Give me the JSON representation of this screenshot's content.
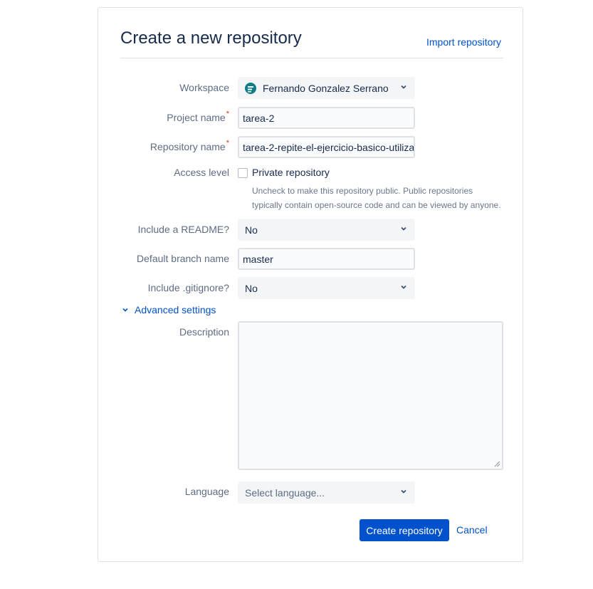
{
  "page": {
    "title": "Create a new repository",
    "import_link": "Import repository"
  },
  "form": {
    "workspace": {
      "label": "Workspace",
      "value": "Fernando Gonzalez Serrano",
      "icon": "workspace-avatar-icon"
    },
    "project_name": {
      "label": "Project name",
      "required_mark": "*",
      "value": "tarea-2"
    },
    "repository_name": {
      "label": "Repository name",
      "required_mark": "*",
      "value": "tarea-2-repite-el-ejercicio-basico-utiliza"
    },
    "access_level": {
      "label": "Access level",
      "checkbox_label": "Private repository",
      "checked": false,
      "help_line1": "Uncheck to make this repository public. Public repositories",
      "help_line2": "typically contain open-source code and can be viewed by anyone."
    },
    "include_readme": {
      "label": "Include a README?",
      "value": "No"
    },
    "default_branch": {
      "label": "Default branch name",
      "value": "master"
    },
    "include_gitignore": {
      "label": "Include .gitignore?",
      "value": "No"
    },
    "advanced_settings": "Advanced settings",
    "description": {
      "label": "Description",
      "value": ""
    },
    "language": {
      "label": "Language",
      "placeholder": "Select language..."
    }
  },
  "actions": {
    "create": "Create repository",
    "cancel": "Cancel"
  },
  "colors": {
    "primary": "#0052cc",
    "required": "#de350b",
    "label": "#5e6c84"
  }
}
